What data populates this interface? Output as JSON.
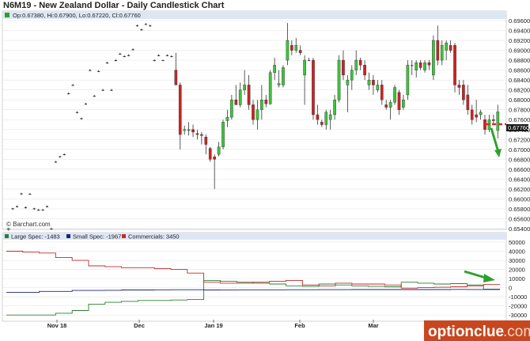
{
  "title": "N6M19 - New Zealand Dollar - Daily Candlestick Chart",
  "ohlc_label": "Op:0.67380, Hi:0.67900, Lo:0.67220, Cl:0.67760",
  "last_price_label": "0.67760",
  "watermark": "© Barchart.com",
  "logo": {
    "main": "optionclue",
    "domain": ".com"
  },
  "colors": {
    "up": "#3cc43c",
    "down": "#cc2222",
    "large_spec": "#2e7d32",
    "small_spec": "#1a237e",
    "commercials": "#c62828",
    "annotation_arrow": "#2fa02f",
    "annotation_dash": "#d32f2f",
    "logo_bg": "#c8471e"
  },
  "legend": [
    {
      "label": "Large Spec: -1483",
      "color": "#2e7d32"
    },
    {
      "label": "Small Spec: -1967",
      "color": "#1a237e"
    },
    {
      "label": "Commercials: 3450",
      "color": "#c62828"
    }
  ],
  "x_labels": [
    "Nov 18",
    "Dec",
    "Jan 19",
    "Feb",
    "Mar"
  ],
  "chart_data": [
    {
      "type": "candlestick",
      "title": "N6M19 - New Zealand Dollar - Daily Candlestick Chart",
      "x_labels": [
        "Nov 18",
        "Dec",
        "Jan 19",
        "Feb",
        "Mar"
      ],
      "ylim": [
        0.654,
        0.696
      ],
      "y_ticks": [
        "0.65400",
        "0.65600",
        "0.65800",
        "0.66000",
        "0.66200",
        "0.66400",
        "0.66600",
        "0.66800",
        "0.67000",
        "0.67200",
        "0.67400",
        "0.67600",
        "0.67800",
        "0.68000",
        "0.68200",
        "0.68400",
        "0.68600",
        "0.68800",
        "0.69000",
        "0.69200",
        "0.69400",
        "0.69600"
      ],
      "last_price": 0.6776,
      "ohlc": [
        [
          0.6538,
          0.6542,
          0.6536,
          0.654
        ],
        [
          0.658,
          0.6582,
          0.6578,
          0.6581
        ],
        [
          0.6585,
          0.6587,
          0.6583,
          0.6585
        ],
        [
          0.661,
          0.6612,
          0.6608,
          0.6611
        ],
        [
          0.6583,
          0.6585,
          0.6581,
          0.6583
        ],
        [
          0.661,
          0.6612,
          0.6609,
          0.661
        ],
        [
          0.658,
          0.6582,
          0.6578,
          0.6581
        ],
        [
          0.6578,
          0.658,
          0.6576,
          0.6578
        ],
        [
          0.6578,
          0.658,
          0.6577,
          0.6578
        ],
        [
          0.6585,
          0.6587,
          0.6583,
          0.6584
        ],
        [
          0.654,
          0.6542,
          0.6538,
          0.654
        ],
        [
          0.6675,
          0.6677,
          0.6673,
          0.6675
        ],
        [
          0.6685,
          0.6687,
          0.6683,
          0.6686
        ],
        [
          0.669,
          0.6692,
          0.6688,
          0.669
        ],
        [
          0.6813,
          0.6815,
          0.6811,
          0.6813
        ],
        [
          0.683,
          0.6832,
          0.6828,
          0.683
        ],
        [
          0.6775,
          0.6777,
          0.6773,
          0.6775
        ],
        [
          0.6762,
          0.6764,
          0.676,
          0.6763
        ],
        [
          0.6792,
          0.6794,
          0.679,
          0.6792
        ],
        [
          0.686,
          0.6862,
          0.6858,
          0.686
        ],
        [
          0.6808,
          0.681,
          0.6806,
          0.6808
        ],
        [
          0.6858,
          0.686,
          0.6856,
          0.6858
        ],
        [
          0.682,
          0.6822,
          0.6818,
          0.682
        ],
        [
          0.6875,
          0.6877,
          0.6873,
          0.6875
        ],
        [
          0.682,
          0.6822,
          0.6818,
          0.682
        ],
        [
          0.688,
          0.6882,
          0.6878,
          0.688
        ],
        [
          0.6893,
          0.6895,
          0.6891,
          0.6893
        ],
        [
          0.6888,
          0.689,
          0.6886,
          0.6888
        ],
        [
          0.689,
          0.6892,
          0.6888,
          0.689
        ],
        [
          0.6902,
          0.6904,
          0.69,
          0.6902
        ],
        [
          0.695,
          0.6952,
          0.6948,
          0.695
        ],
        [
          0.6942,
          0.6944,
          0.694,
          0.6942
        ],
        [
          0.6953,
          0.6955,
          0.6951,
          0.6953
        ],
        [
          0.695,
          0.6952,
          0.6948,
          0.695
        ],
        [
          0.688,
          0.6882,
          0.6878,
          0.688
        ],
        [
          0.689,
          0.6892,
          0.6888,
          0.689
        ],
        [
          0.688,
          0.6881,
          0.6879,
          0.688
        ],
        [
          0.689,
          0.6892,
          0.6888,
          0.689
        ],
        [
          0.6888,
          0.689,
          0.6886,
          0.6888
        ],
        [
          0.686,
          0.6895,
          0.684,
          0.683
        ],
        [
          0.683,
          0.6835,
          0.67,
          0.673
        ],
        [
          0.6738,
          0.6748,
          0.673,
          0.674
        ],
        [
          0.6738,
          0.6755,
          0.6728,
          0.674
        ],
        [
          0.674,
          0.675,
          0.6725,
          0.6735
        ],
        [
          0.6732,
          0.674,
          0.672,
          0.673
        ],
        [
          0.673,
          0.6735,
          0.671,
          0.6728
        ],
        [
          0.6725,
          0.673,
          0.669,
          0.671
        ],
        [
          0.6702,
          0.6705,
          0.6675,
          0.668
        ],
        [
          0.6685,
          0.669,
          0.662,
          0.668
        ],
        [
          0.669,
          0.6715,
          0.6686,
          0.6705
        ],
        [
          0.6705,
          0.676,
          0.67,
          0.6755
        ],
        [
          0.6758,
          0.678,
          0.6745,
          0.6765
        ],
        [
          0.6765,
          0.681,
          0.676,
          0.68
        ],
        [
          0.68,
          0.683,
          0.679,
          0.679
        ],
        [
          0.679,
          0.6835,
          0.6785,
          0.682
        ],
        [
          0.682,
          0.686,
          0.681,
          0.683
        ],
        [
          0.683,
          0.685,
          0.678,
          0.679
        ],
        [
          0.679,
          0.68,
          0.675,
          0.676
        ],
        [
          0.676,
          0.68,
          0.674,
          0.678
        ],
        [
          0.678,
          0.683,
          0.676,
          0.68
        ],
        [
          0.68,
          0.681,
          0.6785,
          0.6792
        ],
        [
          0.6792,
          0.686,
          0.679,
          0.6855
        ],
        [
          0.6855,
          0.6885,
          0.684,
          0.687
        ],
        [
          0.683,
          0.686,
          0.6825,
          0.6833
        ],
        [
          0.683,
          0.687,
          0.6825,
          0.6865
        ],
        [
          0.688,
          0.6955,
          0.687,
          0.692
        ],
        [
          0.691,
          0.692,
          0.689,
          0.69
        ],
        [
          0.69,
          0.6925,
          0.6895,
          0.691
        ],
        [
          0.69,
          0.691,
          0.689,
          0.6895
        ],
        [
          0.685,
          0.689,
          0.679,
          0.688
        ],
        [
          0.688,
          0.6885,
          0.688,
          0.688
        ],
        [
          0.688,
          0.6885,
          0.676,
          0.677
        ],
        [
          0.677,
          0.679,
          0.675,
          0.676
        ],
        [
          0.6755,
          0.676,
          0.6745,
          0.675
        ],
        [
          0.675,
          0.678,
          0.674,
          0.6775
        ],
        [
          0.676,
          0.678,
          0.674,
          0.677
        ],
        [
          0.677,
          0.681,
          0.676,
          0.68
        ],
        [
          0.68,
          0.689,
          0.6795,
          0.688
        ],
        [
          0.688,
          0.69,
          0.684,
          0.685
        ],
        [
          0.683,
          0.685,
          0.6775,
          0.684
        ],
        [
          0.684,
          0.687,
          0.682,
          0.686
        ],
        [
          0.686,
          0.69,
          0.685,
          0.688
        ],
        [
          0.688,
          0.6885,
          0.686,
          0.687
        ],
        [
          0.687,
          0.688,
          0.684,
          0.685
        ],
        [
          0.683,
          0.6855,
          0.682,
          0.684
        ],
        [
          0.684,
          0.685,
          0.681,
          0.683
        ],
        [
          0.682,
          0.684,
          0.6815,
          0.683
        ],
        [
          0.683,
          0.684,
          0.679,
          0.68
        ],
        [
          0.679,
          0.68,
          0.678,
          0.6785
        ],
        [
          0.6785,
          0.68,
          0.676,
          0.6795
        ],
        [
          0.6795,
          0.683,
          0.679,
          0.6825
        ],
        [
          0.6815,
          0.682,
          0.677,
          0.678
        ],
        [
          0.6785,
          0.681,
          0.678,
          0.68
        ],
        [
          0.681,
          0.688,
          0.68,
          0.687
        ],
        [
          0.687,
          0.688,
          0.685,
          0.687
        ],
        [
          0.686,
          0.688,
          0.6845,
          0.6875
        ],
        [
          0.6875,
          0.688,
          0.686,
          0.6865
        ],
        [
          0.686,
          0.688,
          0.6855,
          0.6875
        ],
        [
          0.6875,
          0.688,
          0.686,
          0.687
        ],
        [
          0.685,
          0.693,
          0.684,
          0.692
        ],
        [
          0.692,
          0.695,
          0.687,
          0.688
        ],
        [
          0.688,
          0.692,
          0.687,
          0.691
        ],
        [
          0.69,
          0.692,
          0.688,
          0.6915
        ],
        [
          0.691,
          0.692,
          0.6895,
          0.69
        ],
        [
          0.691,
          0.6915,
          0.6815,
          0.683
        ],
        [
          0.683,
          0.684,
          0.681,
          0.6825
        ],
        [
          0.683,
          0.684,
          0.679,
          0.68
        ],
        [
          0.681,
          0.683,
          0.677,
          0.678
        ],
        [
          0.678,
          0.679,
          0.675,
          0.676
        ],
        [
          0.677,
          0.68,
          0.6755,
          0.6765
        ],
        [
          0.677,
          0.678,
          0.676,
          0.6775
        ],
        [
          0.676,
          0.677,
          0.673,
          0.674
        ],
        [
          0.674,
          0.677,
          0.6735,
          0.676
        ],
        [
          0.676,
          0.677,
          0.675,
          0.6758
        ],
        [
          0.6738,
          0.679,
          0.6722,
          0.6776
        ]
      ]
    },
    {
      "type": "line",
      "title": "",
      "x_labels": [
        "Nov 18",
        "Dec",
        "Jan 19",
        "Feb",
        "Mar"
      ],
      "ylim": [
        -35000,
        50000
      ],
      "y_ticks": [
        "50000",
        "40000",
        "30000",
        "20000",
        "10000",
        "0",
        "-10000",
        "-20000",
        "-30000"
      ],
      "series": [
        {
          "name": "Large Spec",
          "color": "#2e7d32",
          "values": [
            -30000,
            -30000,
            -30000,
            -28000,
            -25000,
            -18000,
            -16000,
            -15000,
            -14000,
            -14000,
            -13500,
            -13000,
            8000,
            7000,
            6000,
            5000,
            4000,
            2000,
            1500,
            4000,
            3000,
            2000,
            1500,
            1000,
            6000,
            5000,
            4000,
            4500,
            3000,
            -1483
          ]
        },
        {
          "name": "Small Spec",
          "color": "#1a237e",
          "values": [
            -5000,
            -5000,
            -4000,
            -4000,
            -3000,
            -3000,
            -2800,
            -2500,
            -2500,
            -2300,
            -2200,
            -2200,
            -2500,
            -2400,
            -2300,
            -2300,
            -2300,
            -2200,
            -2200,
            -2100,
            -2100,
            -2000,
            -2000,
            -2000,
            -2000,
            -2000,
            -2000,
            -1900,
            -1950,
            -1967
          ]
        },
        {
          "name": "Commercials",
          "color": "#c62828",
          "values": [
            40000,
            39000,
            38000,
            33000,
            30000,
            24000,
            23000,
            22000,
            22000,
            21000,
            20000,
            16000,
            6000,
            5000,
            5000,
            6000,
            7000,
            8000,
            3000,
            2000,
            5000,
            4000,
            4000,
            3000,
            -500,
            0,
            500,
            1000,
            2000,
            3450
          ]
        }
      ]
    }
  ]
}
